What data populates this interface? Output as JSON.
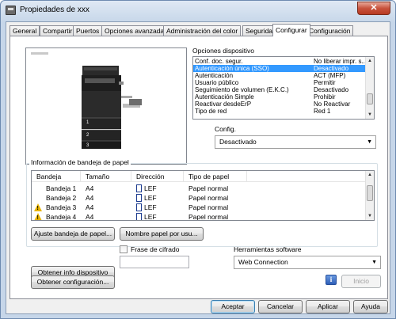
{
  "window": {
    "title": "Propiedades de xxx",
    "close_glyph": "✕"
  },
  "tabs": [
    "General",
    "Compartir",
    "Puertos",
    "Opciones avanzadas",
    "Administración del color",
    "Seguridad",
    "Configurar",
    "Configuración"
  ],
  "active_tab": "Configurar",
  "preview": {
    "tray_numbers": [
      "1",
      "2",
      "3"
    ]
  },
  "device_options": {
    "label": "Opciones dispositivo",
    "rows": [
      {
        "name": "Conf. doc. segur.",
        "value": "No liberar impr. s..."
      },
      {
        "name": "Autenticación única (SSO)",
        "value": "Desactivado",
        "selected": true
      },
      {
        "name": "Autenticación",
        "value": "ACT (MFP)"
      },
      {
        "name": "Usuario público",
        "value": "Permitir"
      },
      {
        "name": "Seguimiento de volumen (E.K.C.)",
        "value": "Desactivado"
      },
      {
        "name": "Autenticación Simple",
        "value": "Prohibir"
      },
      {
        "name": "Reactivar desdeErP",
        "value": "No Reactivar"
      },
      {
        "name": "Tipo de red",
        "value": "Red 1"
      }
    ]
  },
  "config": {
    "label": "Config.",
    "value": "Desactivado"
  },
  "paper_tray": {
    "title": "Información de bandeja de papel",
    "headers": [
      "Bandeja",
      "Tamaño",
      "Dirección",
      "Tipo de papel"
    ],
    "rows": [
      {
        "tray": "Bandeja 1",
        "size": "A4",
        "direction": "LEF",
        "type": "Papel normal",
        "warning": false
      },
      {
        "tray": "Bandeja 2",
        "size": "A4",
        "direction": "LEF",
        "type": "Papel normal",
        "warning": false
      },
      {
        "tray": "Bandeja 3",
        "size": "A4",
        "direction": "LEF",
        "type": "Papel normal",
        "warning": true
      },
      {
        "tray": "Bandeja 4",
        "size": "A4",
        "direction": "LEF",
        "type": "Papel normal",
        "warning": true
      }
    ],
    "tray_settings_button": "Ajuste bandeja de papel...",
    "paper_name_button": "Nombre papel por usu..."
  },
  "device_info_button": "Obtener info dispositivo",
  "passphrase": {
    "label": "Frase de cifrado",
    "value": ""
  },
  "software_tools": {
    "label": "Herramientas software",
    "value": "Web Connection",
    "start_button": "Inicio"
  },
  "get_config_button": "Obtener configuración...",
  "footer": {
    "accept": "Aceptar",
    "cancel": "Cancelar",
    "apply": "Aplicar",
    "help": "Ayuda"
  },
  "colors": {
    "selection": "#3399ff",
    "warning": "#e8b400",
    "titlebar": "#c6d6e9",
    "close": "#c8523c"
  }
}
